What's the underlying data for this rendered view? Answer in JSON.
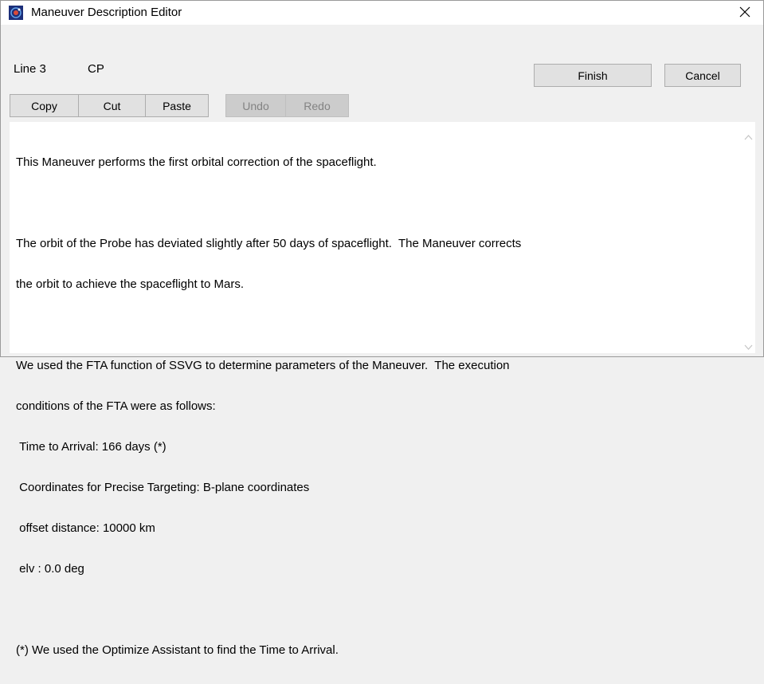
{
  "window": {
    "title": "Maneuver Description Editor",
    "close_icon": "close-icon",
    "app_icon": "probe-orbit-icon"
  },
  "header": {
    "line_label": "Line 3",
    "maneuver_code": "CP"
  },
  "toolbar": {
    "copy_label": "Copy",
    "cut_label": "Cut",
    "paste_label": "Paste",
    "undo_label": "Undo",
    "redo_label": "Redo",
    "finish_label": "Finish",
    "cancel_label": "Cancel"
  },
  "editor": {
    "lines": [
      "This Maneuver performs the first orbital correction of the spaceflight.",
      "",
      "The orbit of the Probe has deviated slightly after 50 days of spaceflight.  The Maneuver corrects",
      "the orbit to achieve the spaceflight to Mars.",
      "",
      "We used the FTA function of SSVG to determine parameters of the Maneuver.  The execution",
      "conditions of the FTA were as follows:",
      " Time to Arrival: 166 days (*)",
      " Coordinates for Precise Targeting: B-plane coordinates",
      " offset distance: 10000 km",
      " elv : 0.0 deg",
      "",
      "(*) We used the Optimize Assistant to find the Time to Arrival."
    ]
  },
  "colors": {
    "window_bg": "#f0f0f0",
    "button_bg": "#e1e1e1",
    "disabled_bg": "#cccccc",
    "disabled_text": "#838383"
  }
}
